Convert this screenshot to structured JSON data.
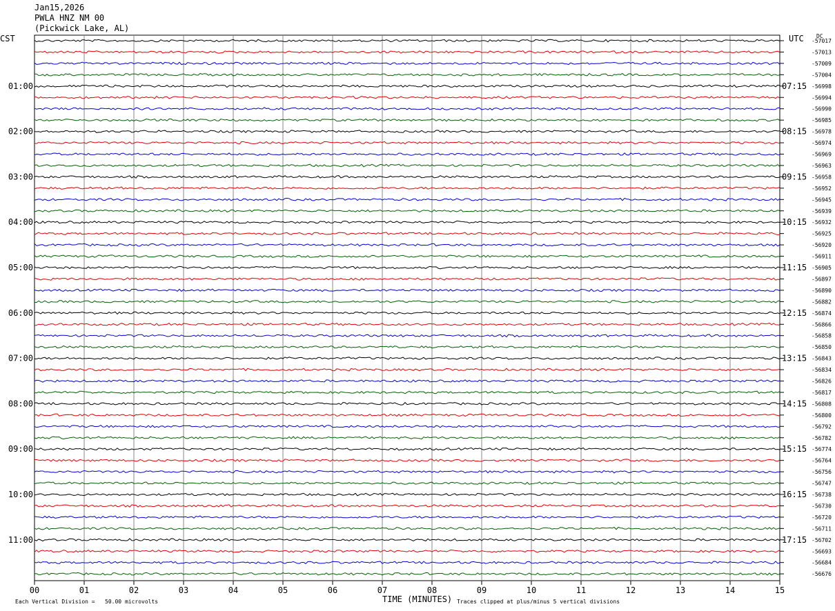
{
  "header": {
    "date": "Jan15,2026",
    "station": "PWLA HNZ NM 00",
    "location": "(Pickwick Lake, AL)"
  },
  "axis": {
    "left_tz": "CST",
    "right_tz": "UTC",
    "right_units": "DC",
    "xlabel": "TIME (MINUTES)",
    "footer_left": "Each Vertical Division =   50.00 microvolts",
    "footer_right": "Traces clipped at plus/minus 5 vertical divisions"
  },
  "colors": {
    "trace_cycle": [
      "#000000",
      "#e00000",
      "#0000d0",
      "#006000"
    ],
    "grid": "#888888"
  },
  "chart_data": {
    "type": "line",
    "title": "",
    "xlabel": "TIME (MINUTES)",
    "xlim": [
      0,
      15
    ],
    "x_ticks": [
      "00",
      "01",
      "02",
      "03",
      "04",
      "05",
      "06",
      "07",
      "08",
      "09",
      "10",
      "11",
      "12",
      "13",
      "14",
      "15"
    ],
    "trace_count": 48,
    "left_hour_labels": [
      "01:00",
      "02:00",
      "03:00",
      "04:00",
      "05:00",
      "06:00",
      "07:00",
      "08:00",
      "09:00",
      "10:00",
      "11:00"
    ],
    "right_hour_labels": [
      "07:15",
      "08:15",
      "09:15",
      "10:15",
      "11:15",
      "12:15",
      "13:15",
      "14:15",
      "15:15",
      "16:15",
      "17:15"
    ],
    "dc_offsets": [
      "-57017",
      "-57013",
      "-57009",
      "-57004",
      "-56998",
      "-56994",
      "-56990",
      "-56985",
      "-56978",
      "-56974",
      "-56969",
      "-56963",
      "-56958",
      "-56952",
      "-56945",
      "-56939",
      "-56932",
      "-56925",
      "-56920",
      "-56911",
      "-56905",
      "-56897",
      "-56890",
      "-56882",
      "-56874",
      "-56866",
      "-56858",
      "-56850",
      "-56843",
      "-56834",
      "-56826",
      "-56817",
      "-56808",
      "-56800",
      "-56792",
      "-56782",
      "-56774",
      "-56764",
      "-56756",
      "-56747",
      "-56738",
      "-56730",
      "-56720",
      "-56711",
      "-56702",
      "-56693",
      "-56684",
      "-56676"
    ]
  }
}
